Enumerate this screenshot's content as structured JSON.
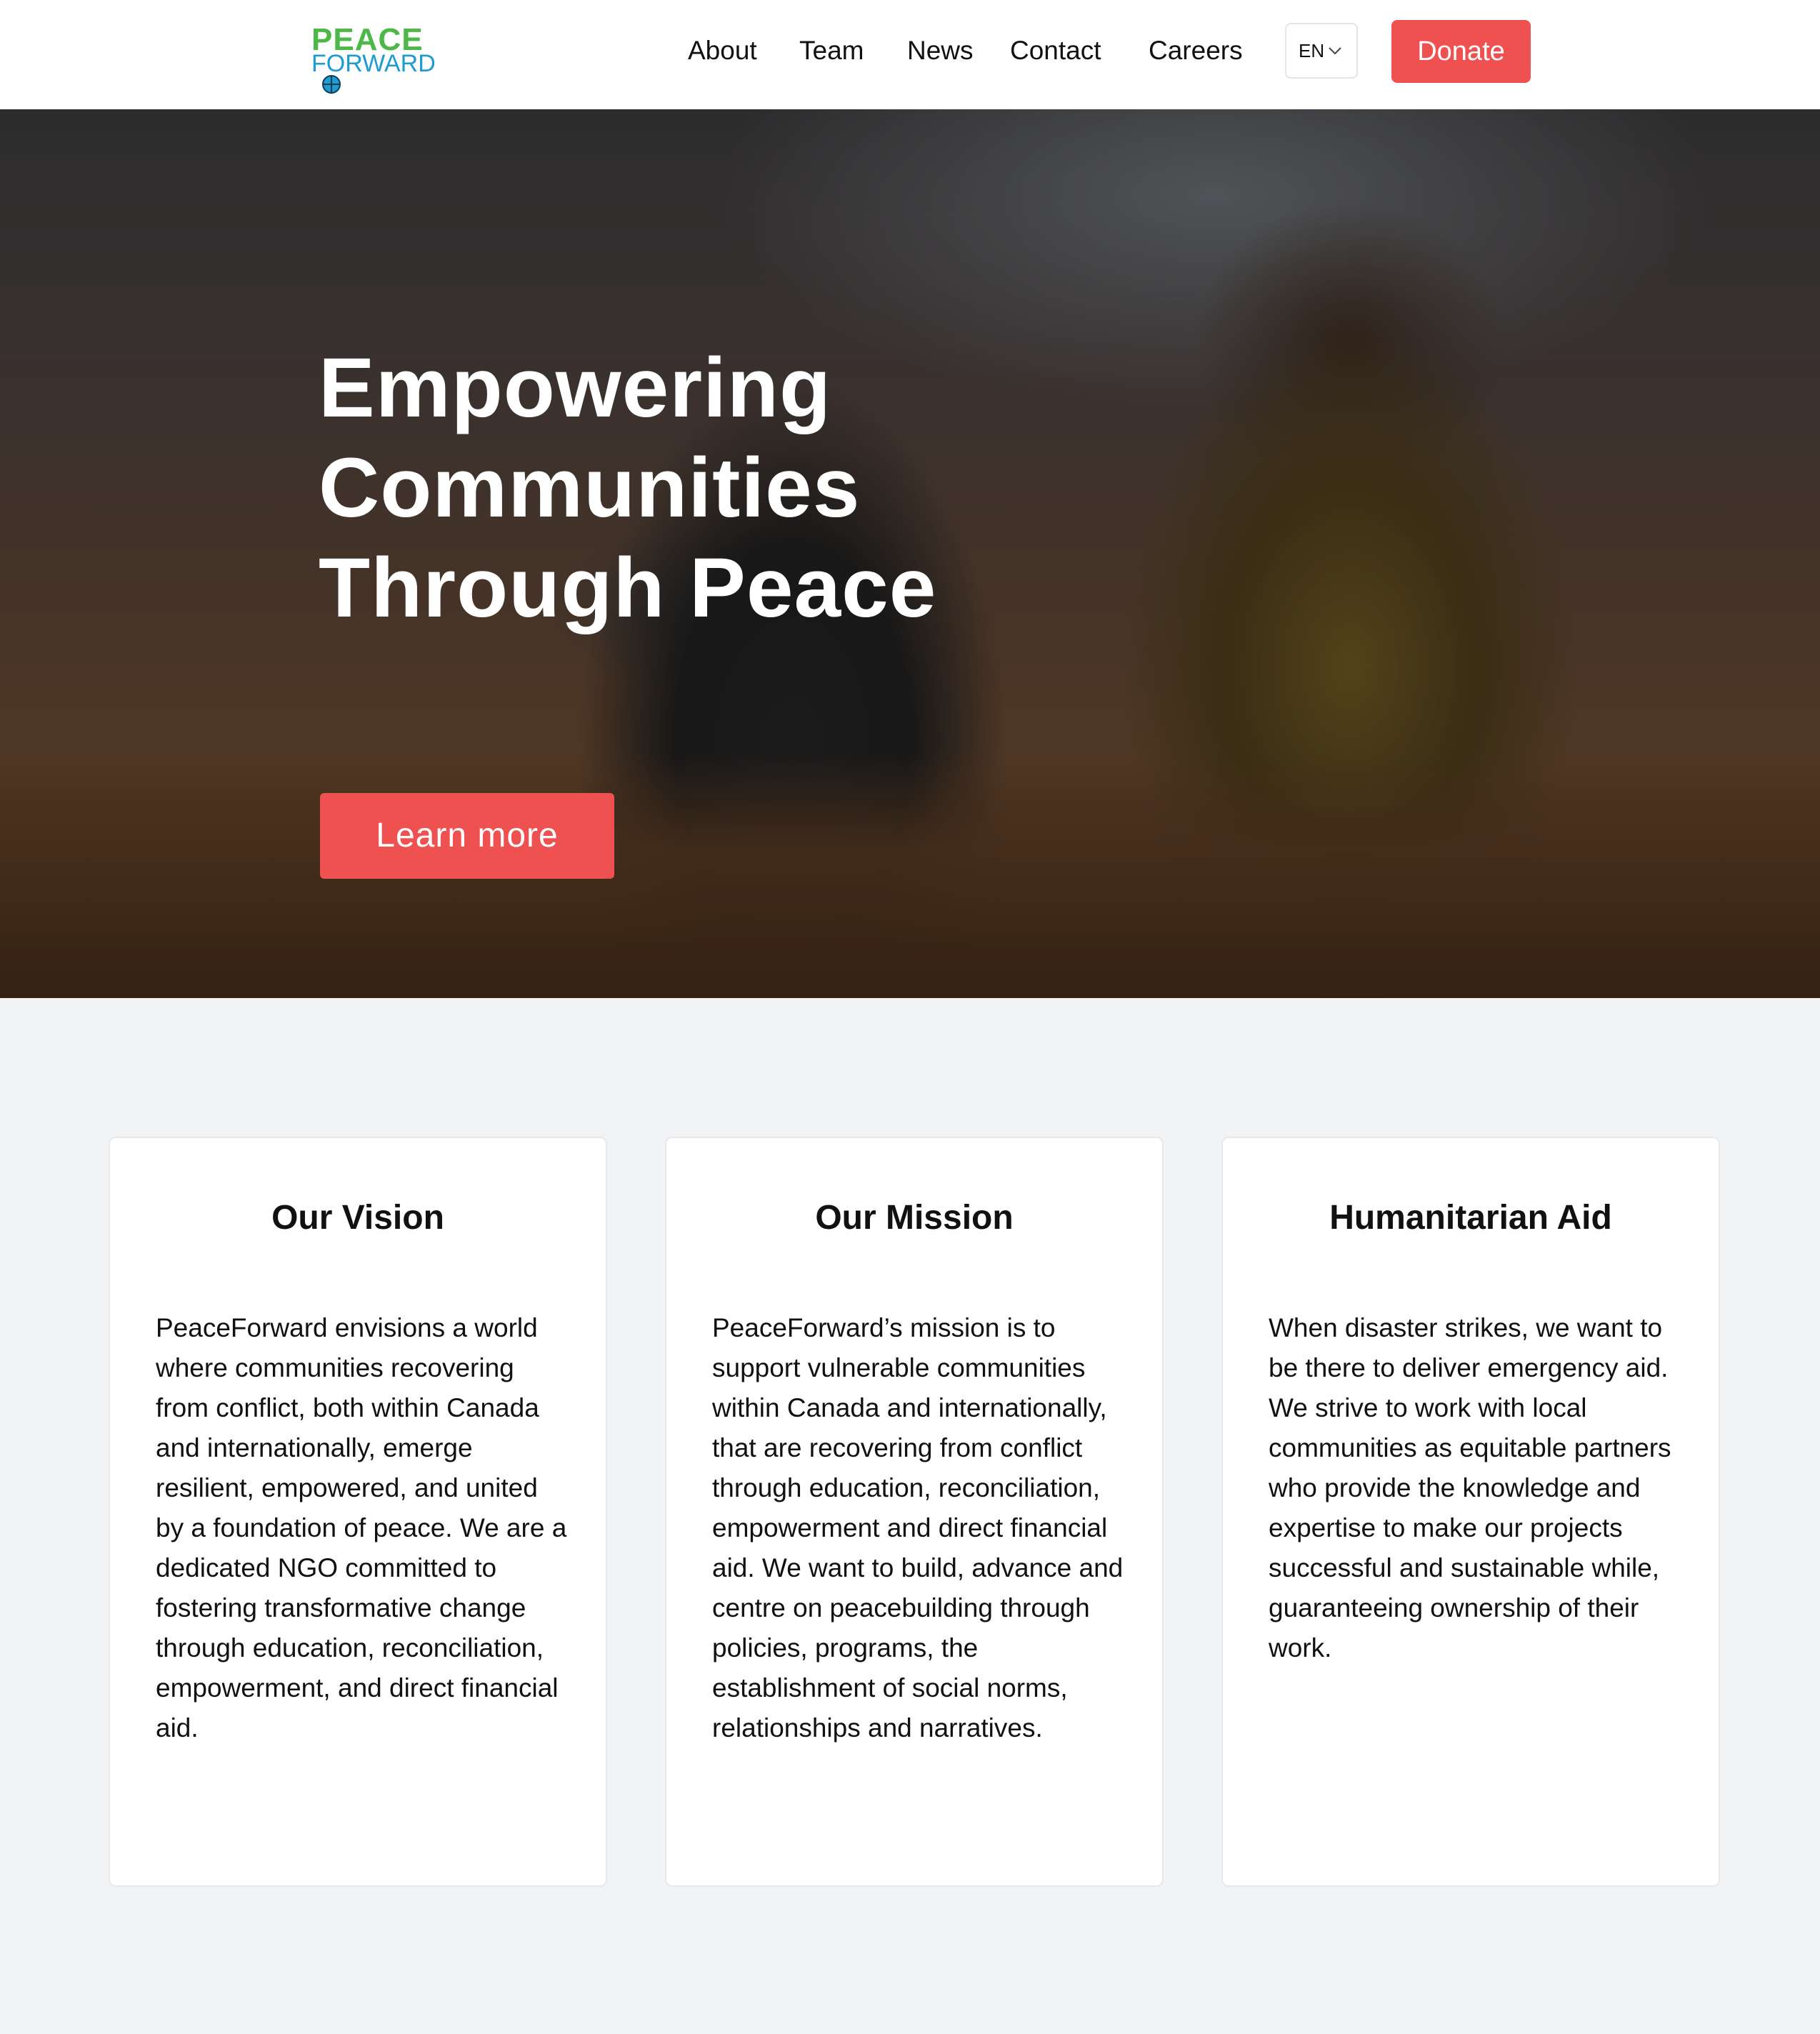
{
  "header": {
    "logo": {
      "line1": "PEACE",
      "line2": "FORWARD"
    },
    "nav": [
      "About",
      "Team",
      "News",
      "Contact",
      "Careers"
    ],
    "language": "EN",
    "donate_label": "Donate"
  },
  "hero": {
    "title_lines": [
      "Empowering",
      "Communities",
      "Through Peace"
    ],
    "cta_label": "Learn more"
  },
  "cards": [
    {
      "title": "Our Vision",
      "body": "PeaceForward envisions a world where communities recovering from conflict, both within Canada and internationally, emerge resilient, empowered, and united by a foundation of peace. We are a dedicated NGO committed to fostering transformative change through education, reconciliation, empowerment, and direct financial aid."
    },
    {
      "title": "Our Mission",
      "body": "PeaceForward’s mission is to support vulnerable communities within Canada and internationally, that are recovering from conflict through education, reconciliation, empowerment and direct financial aid. We want to build, advance and centre on peacebuilding through policies, programs, the establishment of social norms, relationships and narratives."
    },
    {
      "title": "Humanitarian Aid",
      "body": "When disaster strikes, we want to be there to deliver emergency aid. We strive to work with local communities as equitable partners who provide the knowledge and expertise to make our projects successful and sustainable while, guaranteeing ownership of their work."
    }
  ],
  "colors": {
    "accent": "#ef5050",
    "logo_green": "#4cb848",
    "logo_blue": "#1e9bd0",
    "page_background": "#f2f3f5"
  },
  "icons": {
    "logo_globe": "globe-icon",
    "language_dropdown": "chevron-down-icon"
  }
}
